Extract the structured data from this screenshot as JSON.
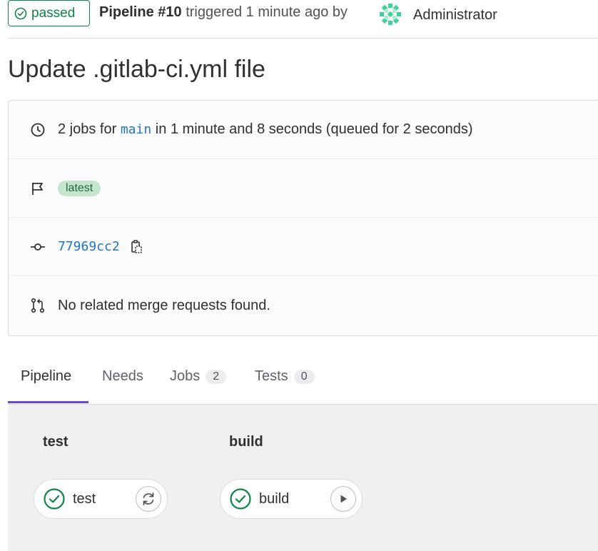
{
  "header": {
    "status": "passed",
    "pipeline_label": "Pipeline #10",
    "triggered_text": "triggered 1 minute ago by",
    "author": "Administrator"
  },
  "title": "Update .gitlab-ci.yml file",
  "info": {
    "jobs_prefix": "2 jobs for",
    "branch": "main",
    "jobs_suffix": "in 1 minute and 8 seconds (queued for 2 seconds)",
    "tag": "latest",
    "commit": "77969cc2",
    "merge_requests": "No related merge requests found."
  },
  "tabs": [
    {
      "label": "Pipeline",
      "active": true
    },
    {
      "label": "Needs"
    },
    {
      "label": "Jobs",
      "count": "2"
    },
    {
      "label": "Tests",
      "count": "0"
    }
  ],
  "stages": [
    {
      "title": "test",
      "job": "test",
      "action": "retry-icon"
    },
    {
      "title": "build",
      "job": "build",
      "action": "play-icon"
    }
  ],
  "colors": {
    "success": "#108548",
    "link": "#1f75cb",
    "tab_accent": "#6e49cb"
  }
}
